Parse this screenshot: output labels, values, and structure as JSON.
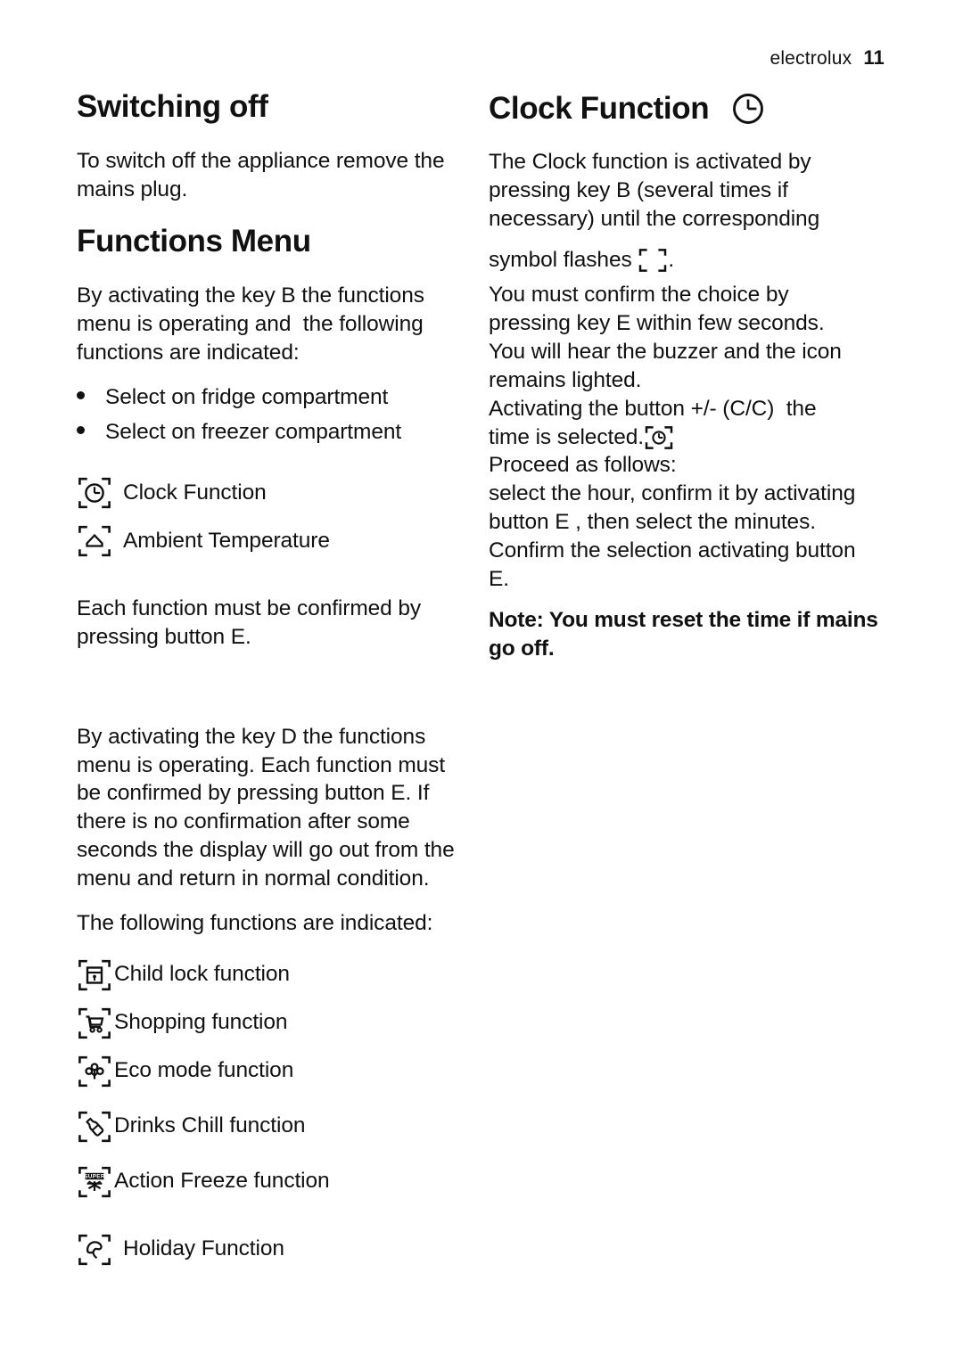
{
  "header": {
    "brand": "electrolux",
    "page_number": "11"
  },
  "left_column": {
    "heading_switching_off": "Switching off",
    "para_switch_off": "To switch off the appliance remove the\nmains plug.",
    "heading_functions_menu": "Functions Menu",
    "para_key_b": "By activating the key B the functions\nmenu is operating and  the following\nfunctions are indicated:",
    "bullets": [
      "Select on fridge compartment",
      "Select on freezer compartment"
    ],
    "menu_icons": [
      {
        "icon": "clock-icon",
        "label": "Clock Function"
      },
      {
        "icon": "house-ambient-temperature-icon",
        "label": "Ambient Temperature"
      }
    ],
    "para_confirm": "Each function must be confirmed by\npressing button E.",
    "para_key_d": "By activating the key D the functions\nmenu is operating. Each function must\nbe confirmed by pressing button E. If\nthere is no confirmation after some\nseconds the display will go out from the\nmenu and return in normal condition.",
    "para_following": "The following functions are indicated:",
    "function_icons": [
      {
        "icon": "padlock-icon",
        "label": "Child lock function"
      },
      {
        "icon": "shopping-cart-icon",
        "label": "Shopping function"
      },
      {
        "icon": "eco-plant-icon",
        "label": "Eco mode function"
      },
      {
        "icon": "bottle-icon",
        "label": "Drinks Chill function"
      },
      {
        "icon": "super-snowflake-icon",
        "label": "Action Freeze function",
        "badge": "SUPER"
      },
      {
        "icon": "umbrella-icon",
        "label": "Holiday Function"
      }
    ]
  },
  "right_column": {
    "heading_clock_function": "Clock Function",
    "heading_icon": "clock-icon",
    "para_activated_1": "The Clock function is activated by\npressing key B (several times if\nnecessary) until the corresponding",
    "symbol_flashes_pre": "symbol flashes ",
    "symbol_flashes_icon": "empty-frame-icon",
    "symbol_flashes_post": ".",
    "para_confirm": "You must confirm the choice by\npressing key E within few seconds.\nYou will hear the buzzer and the icon\nremains lighted.",
    "para_activating_pre": "Activating the button +/- (C/C)  the\ntime is selected.",
    "para_activating_icon": "clock-frame-icon",
    "para_proceed": "Proceed as follows:\nselect the hour, confirm it by activating\nbutton E , then select the minutes.\nConfirm the selection activating button\nE.",
    "note": "Note: You must reset the time if mains\ngo off."
  }
}
